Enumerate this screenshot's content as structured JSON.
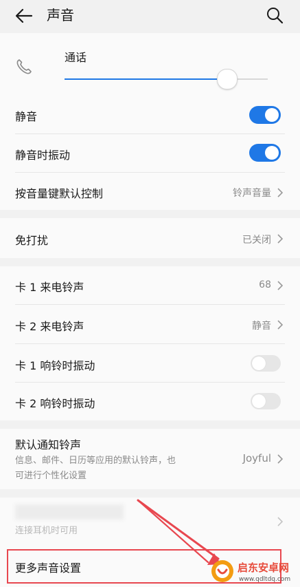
{
  "header": {
    "title": "声音"
  },
  "call": {
    "label": "通话",
    "volume_fraction": 0.8
  },
  "mute": {
    "label": "静音",
    "on": true
  },
  "vibrate_on_mute": {
    "label": "静音时振动",
    "on": true
  },
  "volume_key": {
    "label": "按音量键默认控制",
    "value": "铃声音量"
  },
  "dnd": {
    "label": "免打扰",
    "value": "已关闭"
  },
  "sim1_ringtone": {
    "label": "卡 1 来电铃声",
    "value": "68"
  },
  "sim2_ringtone": {
    "label": "卡 2 来电铃声",
    "value": "静音"
  },
  "sim1_vibrate": {
    "label": "卡 1 响铃时振动",
    "on": false
  },
  "sim2_vibrate": {
    "label": "卡 2 响铃时振动",
    "on": false
  },
  "notification": {
    "label": "默认通知铃声",
    "desc_line1": "信息、邮件、日历等应用的默认铃声，也",
    "desc_line2": "可进行个性化设置",
    "value": "Joyful"
  },
  "headset": {
    "sub": "连接耳机时可用"
  },
  "more": {
    "label": "更多声音设置"
  },
  "colors": {
    "accent": "#1f78e6",
    "annotation": "#e8474f",
    "background": "#f1f1f1",
    "card": "#fafafa"
  },
  "watermark": {
    "name": "启东安卓网",
    "url": "www.qdltdq.com"
  }
}
